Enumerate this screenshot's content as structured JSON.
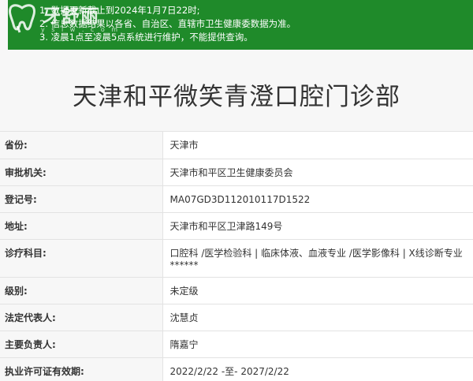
{
  "notice": {
    "lines": [
      "1. 数据更新截止到2024年1月7日22时;",
      "2. 信息数据结果以各省、自治区、直辖市卫生健康委数据为准。",
      "3. 凌晨1点至凌晨5点系统进行维护，不能提供查询。"
    ],
    "background": "#1f8a2a"
  },
  "logo": {
    "text": "牙舒丽",
    "sub": "y s l w . c o m"
  },
  "clinic": {
    "title": "天津和平微笑青澄口腔门诊部"
  },
  "fields": {
    "province_label": "省份:",
    "province_value": "天津市",
    "authority_label": "审批机关:",
    "authority_value": "天津市和平区卫生健康委员会",
    "regno_label": "登记号:",
    "regno_value": "MA07GD3D112010117D1522",
    "address_label": "地址:",
    "address_value": "天津市和平区卫津路149号",
    "specialties_label": "诊疗科目:",
    "specialties_line1": "口腔科 /医学检验科  |  临床体液、血液专业 /医学影像科  |  X线诊断专业",
    "specialties_line2": "******",
    "level_label": "级别:",
    "level_value": "未定级",
    "legal_rep_label": "法定代表人:",
    "legal_rep_value": "沈慧贞",
    "principal_label": "主要负责人:",
    "principal_value": "隋嘉宁",
    "license_label": "执业许可证有效期:",
    "license_value": "2022/2/22 -至- 2027/2/22"
  }
}
